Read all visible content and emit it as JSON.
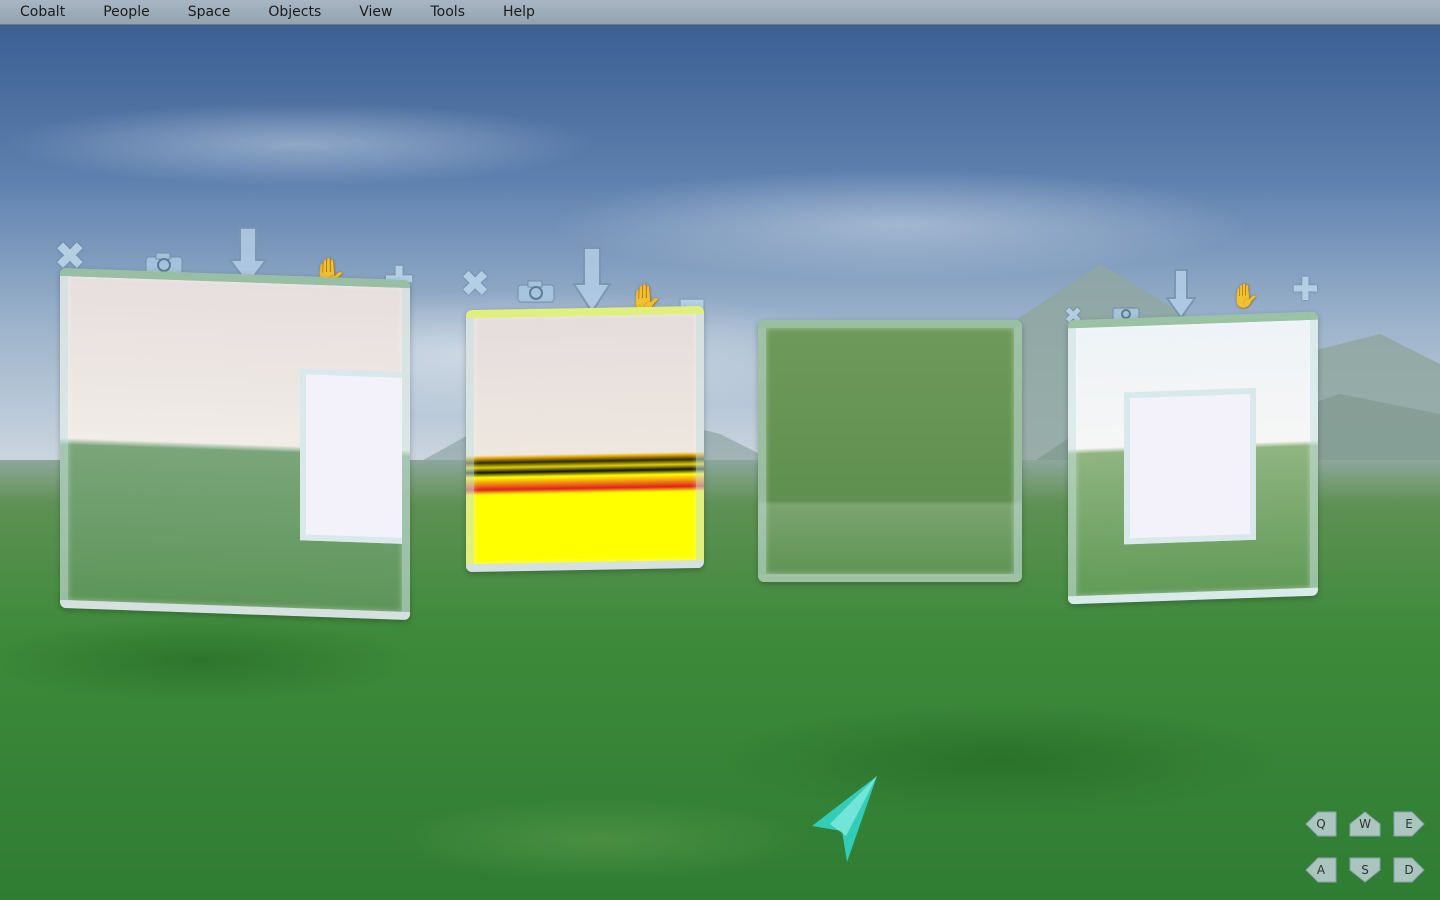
{
  "menu": [
    "Cobalt",
    "People",
    "Space",
    "Objects",
    "View",
    "Tools",
    "Help"
  ],
  "nav_keys": {
    "q": "Q",
    "w": "W",
    "e": "E",
    "a": "A",
    "s": "S",
    "d": "D"
  },
  "colors": {
    "panel_border": "#c8e1e1",
    "cursor": "#33e0d8",
    "stripe_yellow": "#ffff00",
    "stripe_red": "#e02020"
  },
  "icons": [
    "close-icon",
    "camera-icon",
    "drop-arrow-icon",
    "hand-icon",
    "plus-icon",
    "minus-icon"
  ]
}
